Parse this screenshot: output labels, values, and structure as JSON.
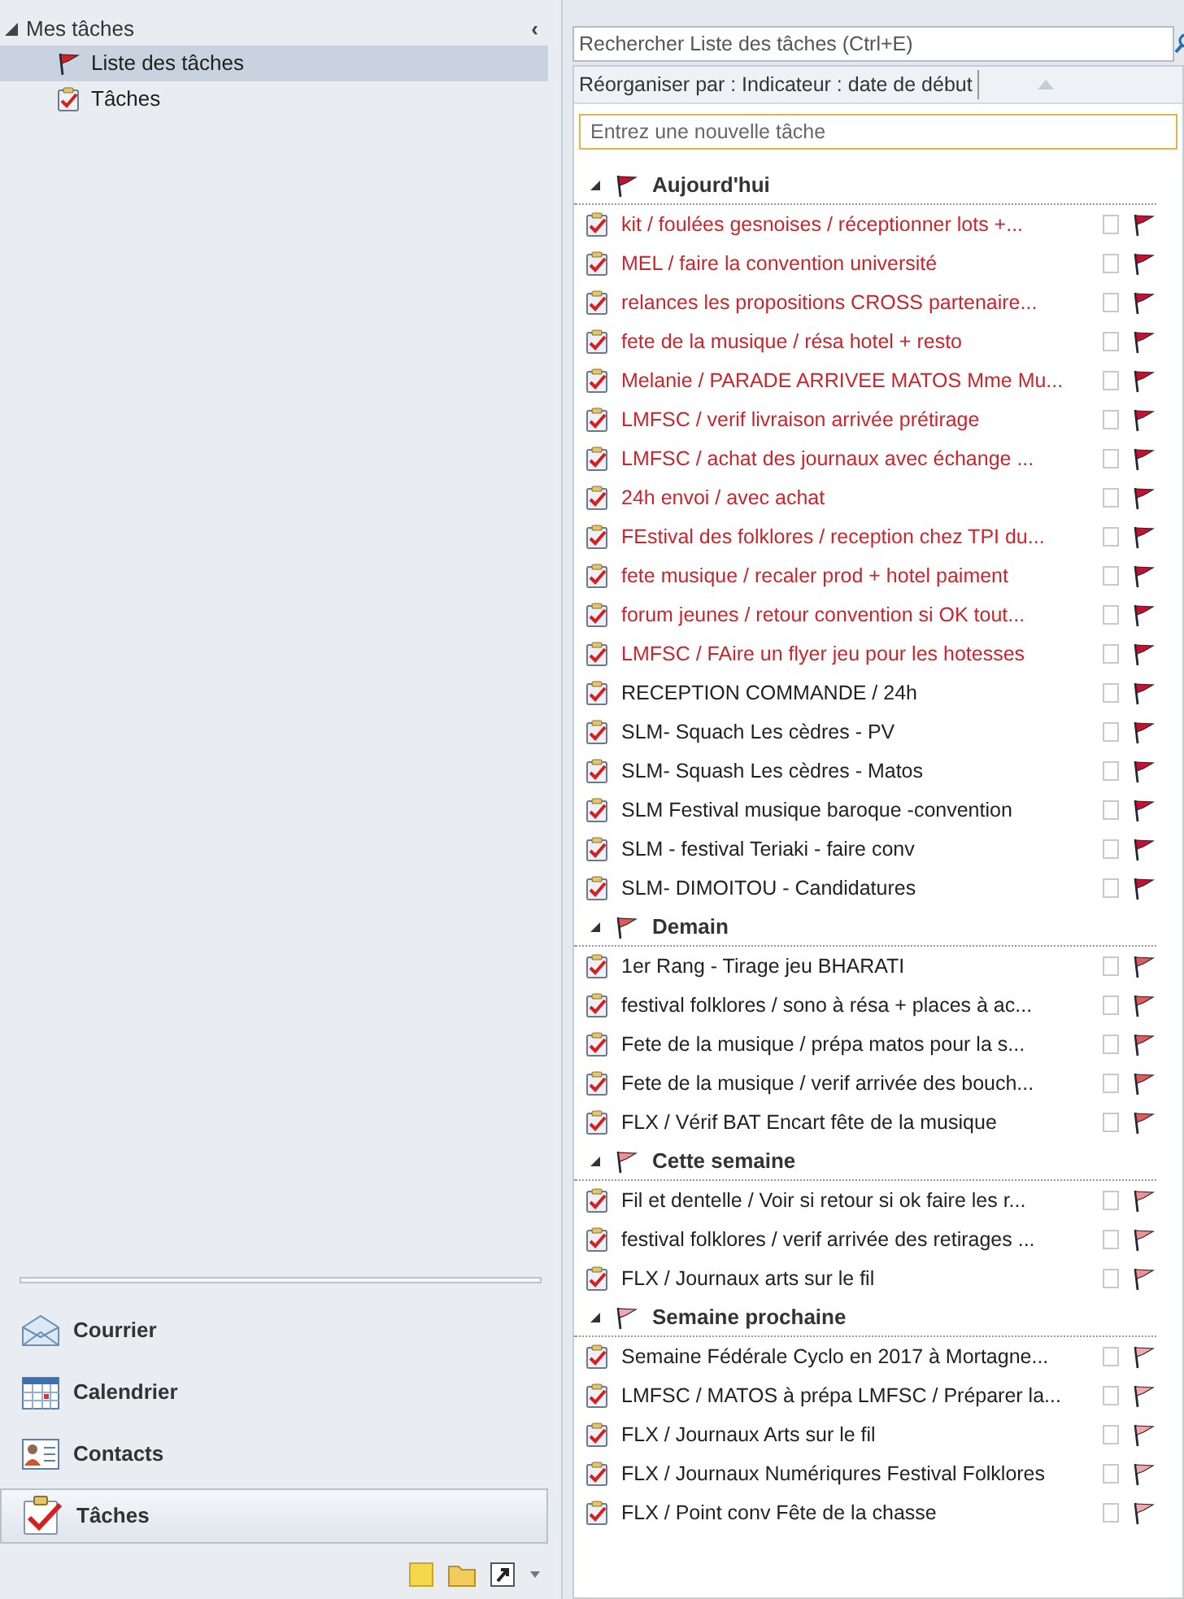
{
  "sidebar": {
    "collapse_glyph": "‹",
    "tree": {
      "label": "Mes tâches",
      "expanded": true,
      "children": [
        {
          "label": "Liste des tâches",
          "kind": "flag",
          "selected": true
        },
        {
          "label": "Tâches",
          "kind": "tasks",
          "selected": false
        }
      ]
    },
    "nav": [
      {
        "label": "Courrier",
        "kind": "mail",
        "selected": false
      },
      {
        "label": "Calendrier",
        "kind": "calendar",
        "selected": false
      },
      {
        "label": "Contacts",
        "kind": "contacts",
        "selected": false
      },
      {
        "label": "Tâches",
        "kind": "tasks",
        "selected": true
      }
    ]
  },
  "search": {
    "placeholder": "Rechercher Liste des tâches (Ctrl+E)"
  },
  "arrange": {
    "label": "Réorganiser par : Indicateur : date de début"
  },
  "new_task": {
    "placeholder": "Entrez une nouvelle tâche"
  },
  "groups": [
    {
      "title": "Aujourd'hui",
      "color": "#c8102e",
      "expanded": true,
      "tasks": [
        {
          "title": "kit / foulées gesnoises / réceptionner lots +...",
          "overdue": true,
          "done": false
        },
        {
          "title": "MEL / faire la convention université",
          "overdue": true,
          "done": false
        },
        {
          "title": "relances les propositions CROSS partenaire...",
          "overdue": true,
          "done": false
        },
        {
          "title": "fete de la musique / résa hotel + resto",
          "overdue": true,
          "done": false
        },
        {
          "title": "Melanie / PARADE ARRIVEE MATOS Mme Mu...",
          "overdue": true,
          "done": false
        },
        {
          "title": "LMFSC / verif livraison arrivée prétirage",
          "overdue": true,
          "done": false
        },
        {
          "title": "LMFSC / achat des journaux  avec échange ...",
          "overdue": true,
          "done": false
        },
        {
          "title": "24h envoi / avec achat",
          "overdue": true,
          "done": false
        },
        {
          "title": "FEstival des folklores / reception chez TPI du...",
          "overdue": true,
          "done": false
        },
        {
          "title": "fete musique / recaler prod + hotel paiment",
          "overdue": true,
          "done": false
        },
        {
          "title": "forum jeunes / retour convention si OK tout...",
          "overdue": true,
          "done": false
        },
        {
          "title": "LMFSC / FAire un flyer jeu pour les hotesses",
          "overdue": true,
          "done": false
        },
        {
          "title": "RECEPTION COMMANDE / 24h",
          "overdue": false,
          "done": false
        },
        {
          "title": "SLM- Squach Les cèdres - PV",
          "overdue": false,
          "done": false
        },
        {
          "title": "SLM- Squash Les cèdres - Matos",
          "overdue": false,
          "done": false
        },
        {
          "title": "SLM Festival musique baroque -convention",
          "overdue": false,
          "done": false
        },
        {
          "title": "SLM - festival Teriaki - faire conv",
          "overdue": false,
          "done": false
        },
        {
          "title": "SLM- DIMOITOU - Candidatures",
          "overdue": false,
          "done": false
        }
      ]
    },
    {
      "title": "Demain",
      "color": "#e05a5a",
      "expanded": true,
      "tasks": [
        {
          "title": "1er Rang - Tirage jeu BHARATI",
          "overdue": false,
          "done": false
        },
        {
          "title": "festival folklores / sono à résa + places à ac...",
          "overdue": false,
          "done": false
        },
        {
          "title": "Fete de la  musique / prépa matos pour la s...",
          "overdue": false,
          "done": false
        },
        {
          "title": "Fete de la  musique / verif arrivée des bouch...",
          "overdue": false,
          "done": false
        },
        {
          "title": "FLX / Vérif BAT Encart fête de la musique",
          "overdue": false,
          "done": false
        }
      ]
    },
    {
      "title": "Cette semaine",
      "color": "#f09090",
      "expanded": true,
      "tasks": [
        {
          "title": "Fil et dentelle / Voir si retour si ok faire les r...",
          "overdue": false,
          "done": false
        },
        {
          "title": "festival folklores / verif arrivée des retirages ...",
          "overdue": false,
          "done": false
        },
        {
          "title": "FLX / Journaux arts sur le fil",
          "overdue": false,
          "done": false
        }
      ]
    },
    {
      "title": "Semaine prochaine",
      "color": "#f4a8a8",
      "expanded": true,
      "tasks": [
        {
          "title": "Semaine Fédérale Cyclo en 2017 à Mortagne...",
          "overdue": false,
          "done": false
        },
        {
          "title": "LMFSC / MATOS à prépa LMFSC / Préparer la...",
          "overdue": false,
          "done": false
        },
        {
          "title": "FLX / Journaux Arts sur le fil",
          "overdue": false,
          "done": false
        },
        {
          "title": "FLX / Journaux Numériqures Festival Folklores",
          "overdue": false,
          "done": false
        },
        {
          "title": "FLX / Point conv Fête de la chasse",
          "overdue": false,
          "done": false
        }
      ]
    }
  ]
}
